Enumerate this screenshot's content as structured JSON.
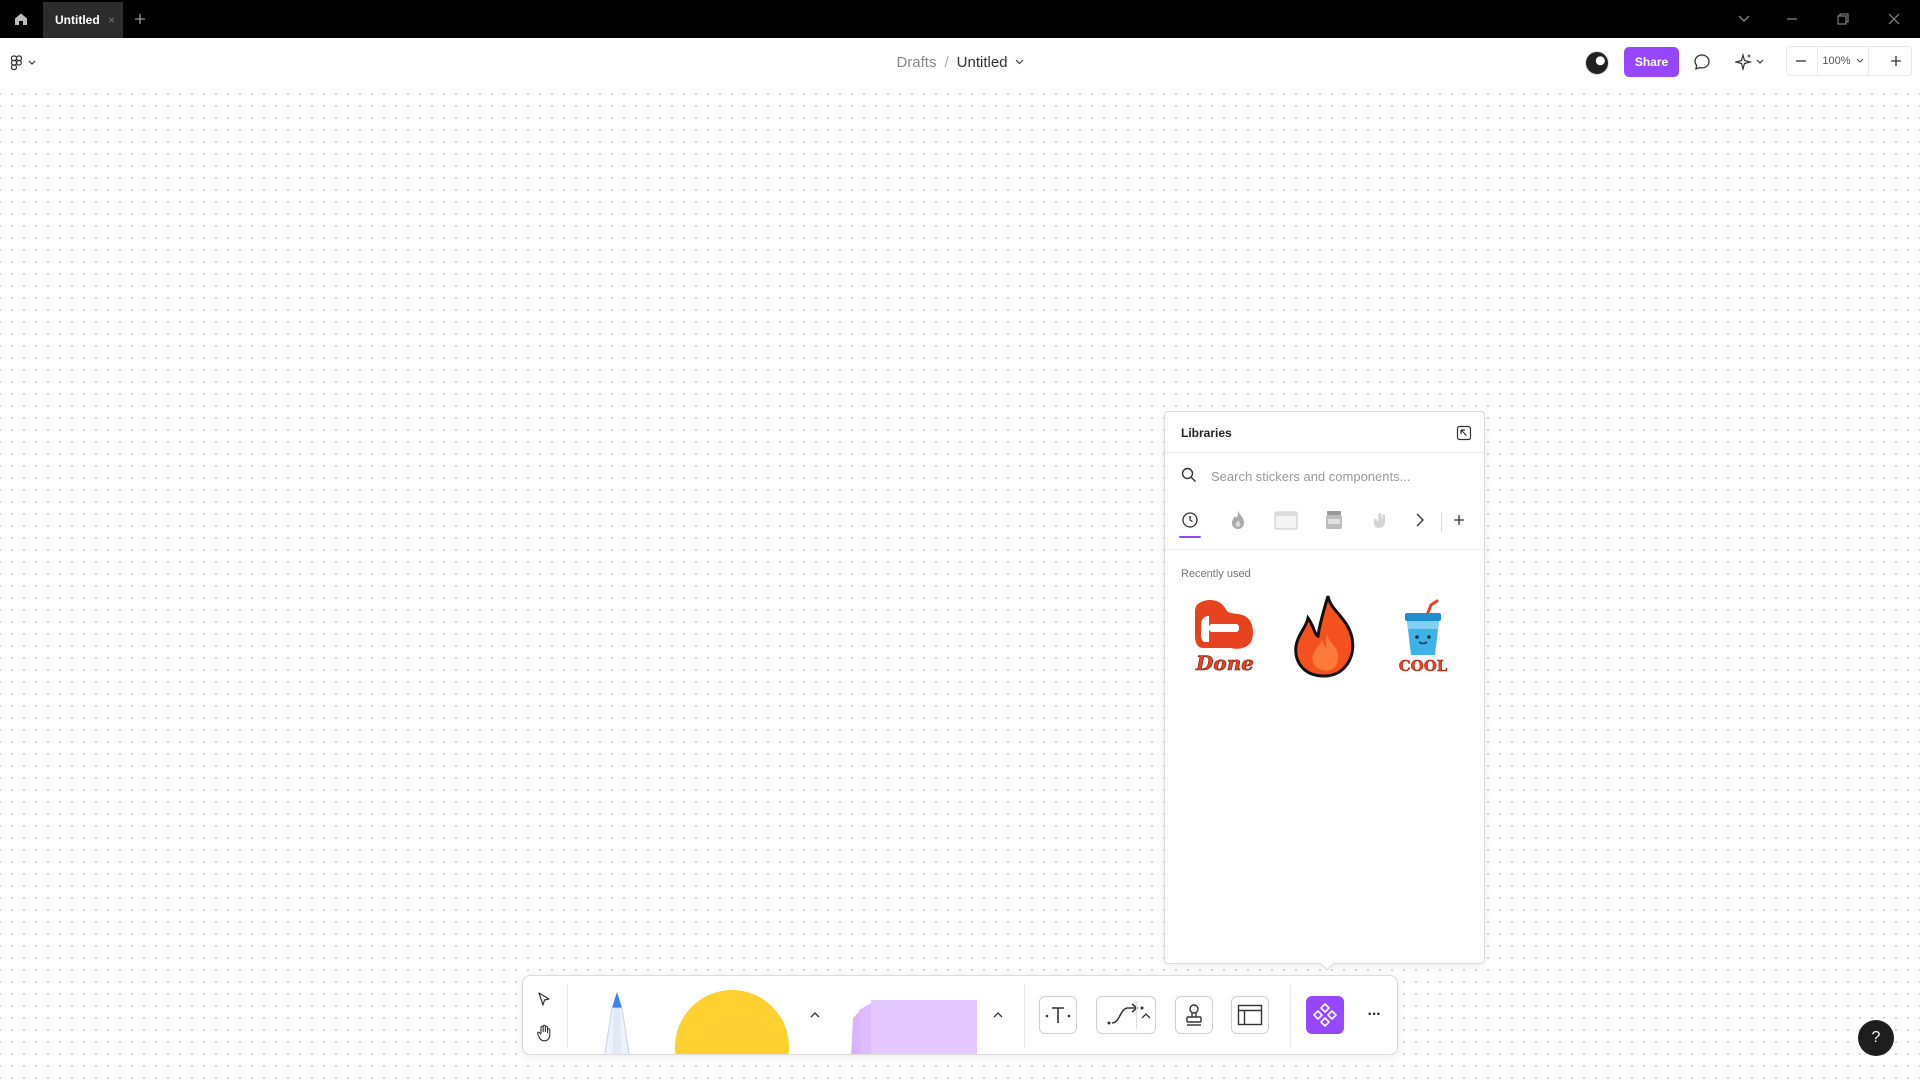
{
  "titlebar": {
    "tab_title": "Untitled",
    "tab_close": "×",
    "new_tab": "+"
  },
  "header": {
    "breadcrumb_parent": "Drafts",
    "breadcrumb_sep": "/",
    "file_title": "Untitled",
    "share_label": "Share",
    "zoom_value": "100%"
  },
  "libraries": {
    "title": "Libraries",
    "search_placeholder": "Search stickers and components...",
    "tabs": [
      "recent-clock-icon",
      "fire-sticker-tab",
      "calendar-sticker-tab",
      "jar-sticker-tab",
      "hand-sticker-tab",
      "chevron-right-icon",
      "plus-icon"
    ],
    "recent_label": "Recently used",
    "stickers": [
      {
        "name": "done-sticker",
        "text": "Done",
        "color": "#e8431f"
      },
      {
        "name": "fire-sticker",
        "text": "",
        "color": "#f4511e"
      },
      {
        "name": "cool-sticker",
        "text": "COOL",
        "color": "#3fb2e8"
      }
    ]
  },
  "toolbar": {
    "tools": [
      "move-tool",
      "hand-tool",
      "marker-tool",
      "shape-tool",
      "sticky-note-tool",
      "text-tool",
      "connector-tool",
      "stamp-tool",
      "section-tool",
      "assets-tool",
      "more-tools"
    ],
    "accent": "#9747ff",
    "more_label": "···"
  },
  "help": {
    "label": "?"
  },
  "colors": {
    "accent": "#9747ff",
    "shape_yellow": "#ffd02f",
    "sticky_purple": "#e4c7ff"
  }
}
